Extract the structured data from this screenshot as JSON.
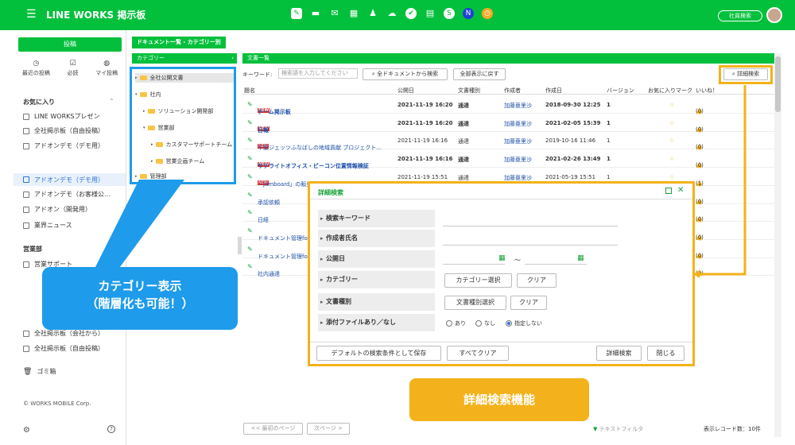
{
  "header": {
    "brand": "LINE WORKS 掲示板",
    "employee_search": "社員検索"
  },
  "sidebar": {
    "post_button": "投稿",
    "quick": [
      {
        "icon": "clock-icon",
        "label": "最近の投稿"
      },
      {
        "icon": "check-icon",
        "label": "必読"
      },
      {
        "icon": "chat-icon",
        "label": "マイ投稿"
      }
    ],
    "favorites_title": "お気に入り",
    "favorites": [
      "LINE WORKSプレゼン",
      "全社掲示板（自由投稿）",
      "アドオンデモ（デモ用）"
    ],
    "boards": [
      "アドオンデモ（デモ用）",
      "アドオンデモ（お客様公...",
      "アドオン（開発用）",
      "業界ニュース"
    ],
    "section2_title": "営業部",
    "section2_items": [
      "営業サポート",
      "全社掲示板（会社から）",
      "全社掲示板（自由投稿）"
    ],
    "trash": "ゴミ箱",
    "copyright": "© WORKS MOBILE Corp."
  },
  "breadcrumb": "ドキュメント一覧 - カテゴリー別",
  "categories": {
    "header": "カテゴリー",
    "items": [
      "全社公開文書",
      "社内",
      "ソリューション開発部",
      "営業部",
      "カスタマーサポートチーム",
      "営業企画チーム",
      "管理部"
    ]
  },
  "list": {
    "header": "文書一覧",
    "keyword_label": "キーワード:",
    "keyword_placeholder": "検索語を入力してください",
    "search_all_button": "全ドキュメントから検索",
    "show_all_button": "全部表示に戻す",
    "detail_search_button": "詳細検索",
    "columns": [
      "題名",
      "公開日",
      "文書種別",
      "作成者",
      "作成日",
      "バージョン",
      "お気に入りマーク",
      "いいね！"
    ],
    "rows": [
      {
        "title": "チーム掲示板",
        "new": true,
        "bold": true,
        "date": "2021-11-19 16:20",
        "type": "通達",
        "author": "加藤亜里沙",
        "created": "2018-09-30 12:25",
        "version": "1",
        "likes": "(0)"
      },
      {
        "title": "日報",
        "new": true,
        "bold": true,
        "date": "2021-11-19 16:20",
        "type": "通達",
        "author": "加藤亜里沙",
        "created": "2021-02-05 15:39",
        "version": "1",
        "likes": "(0)"
      },
      {
        "title": "千葉ジェッツふなばしの地域貢献 プロジェクト...",
        "new": true,
        "bold": false,
        "date": "2021-11-19 16:16",
        "type": "通達",
        "author": "加藤亜里沙",
        "created": "2019-10-16 11:46",
        "version": "1",
        "likes": "(0)"
      },
      {
        "title": "サテライトオフィス・ビーコン位置情報検証",
        "new": true,
        "bold": true,
        "date": "2021-11-19 16:16",
        "type": "通達",
        "author": "加藤亜里沙",
        "created": "2021-02-26 13:49",
        "version": "1",
        "likes": "(0)"
      },
      {
        "title": "「Jamboard」の販売開始",
        "new": true,
        "bold": false,
        "date": "2021-11-19 15:51",
        "type": "通達",
        "author": "加藤亜里沙",
        "created": "2021-05-19 15:51",
        "version": "1",
        "likes": "(1)"
      },
      {
        "title": "承認依頼",
        "new": false,
        "bold": false,
        "date": "",
        "type": "",
        "author": "",
        "created": "",
        "version": "",
        "likes": "(0)"
      },
      {
        "title": "日経",
        "new": false,
        "bold": false,
        "date": "",
        "type": "",
        "author": "",
        "created": "",
        "version": "",
        "likes": "(0)"
      },
      {
        "title": "ドキュメント管理fo",
        "new": false,
        "bold": false,
        "date": "",
        "type": "",
        "author": "",
        "created": "",
        "version": "",
        "likes": "(0)"
      },
      {
        "title": "ドキュメント管理fo",
        "new": false,
        "bold": false,
        "date": "",
        "type": "",
        "author": "",
        "created": "",
        "version": "",
        "likes": "(0)"
      },
      {
        "title": "社内通達",
        "new": false,
        "bold": false,
        "date": "",
        "type": "",
        "author": "",
        "created": "",
        "version": "",
        "likes": "(0)"
      }
    ],
    "first_page_button": "<< 最初のページ",
    "next_page_button": "次ページ >",
    "text_filter": "テキストフィルタ",
    "record_count": "表示レコード数：10件"
  },
  "modal": {
    "title": "詳細検索",
    "fields": [
      "検索キーワード",
      "作成者氏名",
      "公開日",
      "カテゴリー",
      "文書種別",
      "添付ファイルあり／なし"
    ],
    "date_separator": "〜",
    "category_select": "カテゴリー選択",
    "type_select": "文書種別選択",
    "clear": "クリア",
    "radio_options": [
      "あり",
      "なし",
      "指定しない"
    ],
    "save_default": "デフォルトの検索条件として保存",
    "clear_all": "すべてクリア",
    "search": "詳細検索",
    "close": "閉じる"
  },
  "callouts": {
    "category_line1": "カテゴリー表示",
    "category_line2": "（階層化も可能！）",
    "detail_search": "詳細検索機能"
  },
  "colors": {
    "brand_green": "#03c03c",
    "callout_blue": "#1e9bea",
    "callout_orange": "#f3b21b"
  }
}
